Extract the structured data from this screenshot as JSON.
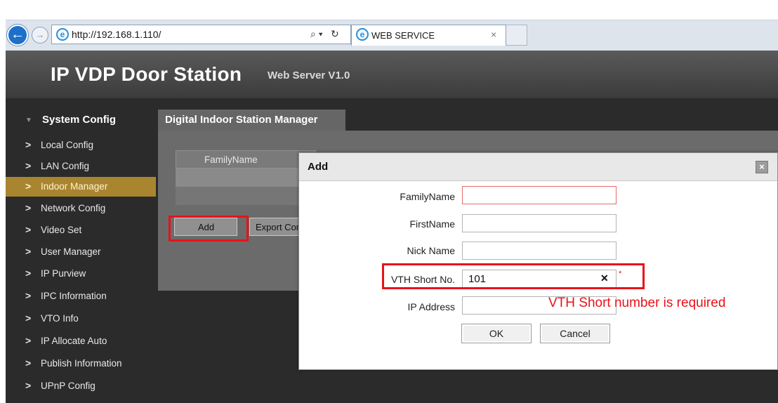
{
  "browser": {
    "url": "http://192.168.1.110/",
    "tab_title": "WEB SERVICE",
    "tab_close": "×",
    "search_glyph": "⌕ ▾",
    "refresh_glyph": "↻",
    "back_glyph": "←",
    "forward_glyph": "→"
  },
  "header": {
    "title": "IP VDP Door Station",
    "version": "Web Server V1.0"
  },
  "sidebar": {
    "heading": "System Config",
    "items": [
      {
        "label": "Local Config"
      },
      {
        "label": "LAN Config"
      },
      {
        "label": "Indoor Manager",
        "active": true
      },
      {
        "label": "Network Config"
      },
      {
        "label": "Video Set"
      },
      {
        "label": "User Manager"
      },
      {
        "label": "IP Purview"
      },
      {
        "label": "IPC Information"
      },
      {
        "label": "VTO Info"
      },
      {
        "label": "IP Allocate Auto"
      },
      {
        "label": "Publish Information"
      },
      {
        "label": "UPnP Config"
      }
    ]
  },
  "content": {
    "tab_label": "Digital Indoor Station Manager",
    "table_header": "FamilyName",
    "add_button": "Add",
    "export_button": "Export Config"
  },
  "dialog": {
    "title": "Add",
    "close_glyph": "×",
    "fields": {
      "family_name": {
        "label": "FamilyName",
        "value": ""
      },
      "first_name": {
        "label": "FirstName",
        "value": ""
      },
      "nick_name": {
        "label": "Nick Name",
        "value": ""
      },
      "vth_short_no": {
        "label": "VTH Short No.",
        "value": "101"
      },
      "ip_address": {
        "label": "IP Address",
        "value": ""
      }
    },
    "clear_glyph": "✕",
    "required_mark": "*",
    "validation_message": "VTH Short number is required",
    "ok_button": "OK",
    "cancel_button": "Cancel"
  },
  "colors": {
    "highlight": "#e8121a",
    "active_menu": "#a9852f",
    "sidebar_bg": "#2b2b2b",
    "browser_accent": "#1e6fc9"
  }
}
